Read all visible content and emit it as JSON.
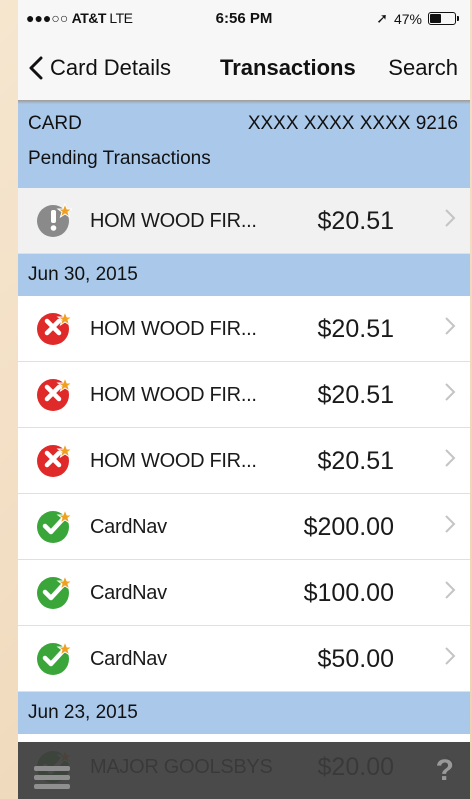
{
  "status_bar": {
    "signal": "●●●○○",
    "carrier": "AT&T",
    "network": "LTE",
    "time": "6:56 PM",
    "location_arrow": "➚",
    "battery_percent_label": "47%",
    "battery_level": 0.47
  },
  "nav": {
    "back_label": "Card Details",
    "title": "Transactions",
    "search_label": "Search"
  },
  "card": {
    "label": "CARD",
    "number": "XXXX XXXX XXXX 9216"
  },
  "pending_header": "Pending Transactions",
  "pending": [
    {
      "merchant": "HOM WOOD FIR...",
      "amount": "$20.51",
      "status": "pending"
    }
  ],
  "groups": [
    {
      "date": "Jun 30, 2015",
      "transactions": [
        {
          "merchant": "HOM WOOD FIR...",
          "amount": "$20.51",
          "status": "declined"
        },
        {
          "merchant": "HOM WOOD FIR...",
          "amount": "$20.51",
          "status": "declined"
        },
        {
          "merchant": "HOM WOOD FIR...",
          "amount": "$20.51",
          "status": "declined"
        },
        {
          "merchant": "CardNav",
          "amount": "$200.00",
          "status": "approved"
        },
        {
          "merchant": "CardNav",
          "amount": "$100.00",
          "status": "approved"
        },
        {
          "merchant": "CardNav",
          "amount": "$50.00",
          "status": "approved"
        }
      ]
    },
    {
      "date": "Jun 23, 2015",
      "transactions": [
        {
          "merchant": "MAJOR GOOLSBYS",
          "amount": "$20.00",
          "status": "approved"
        }
      ]
    }
  ],
  "tab_bar": {
    "help_label": "?"
  },
  "colors": {
    "section_blue": "#a9c8ea",
    "declined_red": "#e02a2a",
    "approved_green": "#3aa63a",
    "pending_gray": "#8a8a8a",
    "star_orange": "#f0a020"
  },
  "icons": {
    "pending": "exclamation-icon",
    "declined": "x-icon",
    "approved": "checkmark-icon",
    "menu": "hamburger-menu-icon",
    "help": "question-mark-icon",
    "chevron": "chevron-right-icon",
    "back": "chevron-left-icon"
  }
}
